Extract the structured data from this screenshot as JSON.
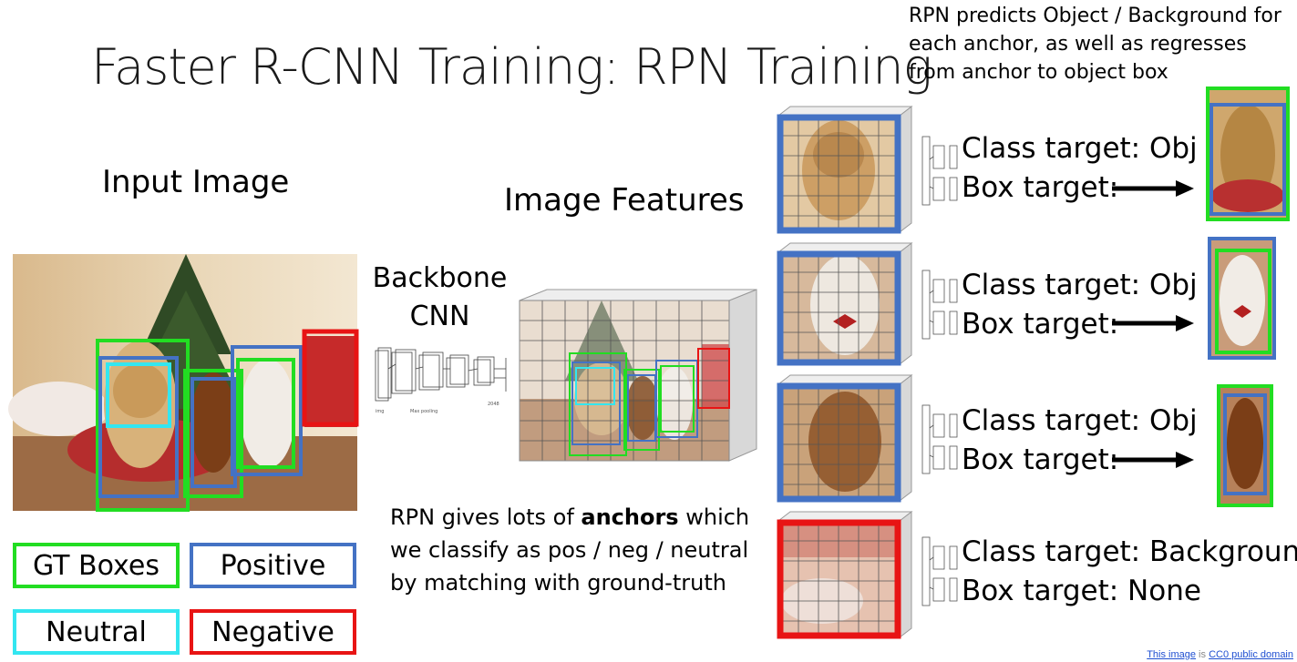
{
  "title": "Faster R-CNN Training: RPN Training",
  "note": "RPN predicts Object / Background for each anchor, as well as regresses from anchor to object box",
  "input_label": "Input Image",
  "backbone_label_1": "Backbone",
  "backbone_label_2": "CNN",
  "features_label": "Image Features",
  "description": {
    "pre": "RPN gives lots of ",
    "bold": "anchors",
    "post": " which we classify as pos / neg / neutral by matching with ground-truth"
  },
  "legend": [
    {
      "label": "GT Boxes",
      "color": "#22dd22"
    },
    {
      "label": "Positive",
      "color": "#4472c4"
    },
    {
      "label": "Neutral",
      "color": "#33e6f0"
    },
    {
      "label": "Negative",
      "color": "#e81414"
    }
  ],
  "targets": [
    {
      "class": "Class target: Obj",
      "box": "Box target:",
      "arrow": true,
      "anchor_color": "#4472c4"
    },
    {
      "class": "Class target: Obj",
      "box": "Box target:",
      "arrow": true,
      "anchor_color": "#4472c4"
    },
    {
      "class": "Class target: Obj",
      "box": "Box target:",
      "arrow": true,
      "anchor_color": "#4472c4"
    },
    {
      "class": "Class target: Background",
      "box": "Box target: None",
      "arrow": false,
      "anchor_color": "#e81414"
    }
  ],
  "credit": {
    "link1": "This image",
    "mid": " is ",
    "link2": "CC0 public domain"
  },
  "colors": {
    "gt": "#22dd22",
    "positive": "#4472c4",
    "neutral": "#33e6f0",
    "negative": "#e81414"
  }
}
